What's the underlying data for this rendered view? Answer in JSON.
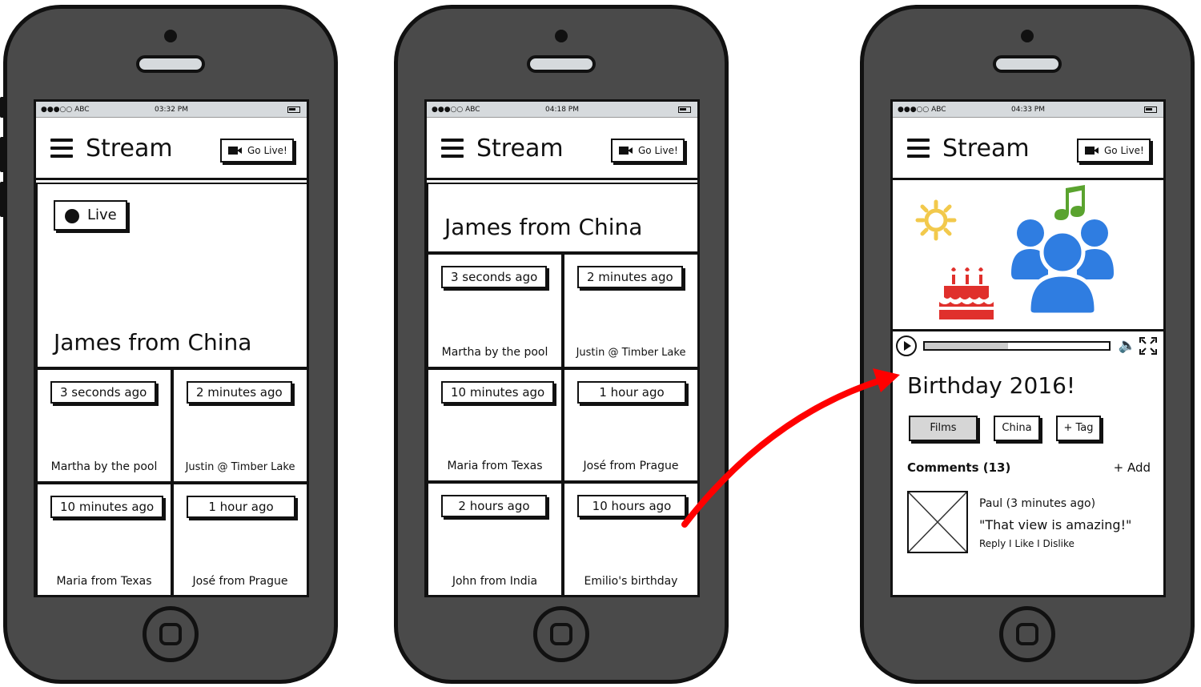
{
  "status_bar": {
    "carrier": "●●●○○ ABC"
  },
  "phones": [
    {
      "time": "03:32 PM",
      "title": "Stream",
      "go_live": "Go Live!",
      "live_label": "Live",
      "feature_title": "James from China",
      "tiles": [
        {
          "badge": "3 seconds ago",
          "caption": "Martha by the pool"
        },
        {
          "badge": "2 minutes ago",
          "caption": "Justin @ Timber Lake"
        },
        {
          "badge": "10 minutes ago",
          "caption": "Maria from Texas"
        },
        {
          "badge": "1 hour ago",
          "caption": "José from Prague"
        }
      ]
    },
    {
      "time": "04:18 PM",
      "title": "Stream",
      "go_live": "Go Live!",
      "feature_title": "James from China",
      "tiles": [
        {
          "badge": "3 seconds ago",
          "caption": "Martha by the pool"
        },
        {
          "badge": "2 minutes ago",
          "caption": "Justin @ Timber Lake"
        },
        {
          "badge": "10 minutes ago",
          "caption": "Maria from Texas"
        },
        {
          "badge": "1 hour ago",
          "caption": "José from Prague"
        },
        {
          "badge": "2 hours ago",
          "caption": "John from India"
        },
        {
          "badge": "10 hours ago",
          "caption": "Emilio's birthday"
        }
      ]
    },
    {
      "time": "04:33 PM",
      "title": "Stream",
      "go_live": "Go Live!",
      "video_title": "Birthday 2016!",
      "video_progress": 0.45,
      "tags": [
        "Films",
        "China",
        "+ Tag"
      ],
      "comments_header": "Comments (13)",
      "add_comment": "+ Add",
      "comment": {
        "author": "Paul (3 minutes ago)",
        "text": "\"That view is amazing!\"",
        "actions": "Reply I Like I Dislike"
      }
    }
  ],
  "colors": {
    "phone_body": "#4a4a4a",
    "status_bar": "#d6dadd",
    "arrow": "#ff0000",
    "people_icon": "#2f7de1",
    "music_icon": "#5aa32f",
    "sun_icon": "#f2c94c",
    "cake_icon": "#e0302c",
    "selected_tag": "#d6d6d6"
  },
  "icons": [
    "hamburger-icon",
    "video-camera-icon",
    "live-dot-icon",
    "sun-icon",
    "cake-icon",
    "people-icon",
    "music-note-icon",
    "play-icon",
    "volume-icon",
    "fullscreen-icon",
    "image-placeholder-icon"
  ]
}
